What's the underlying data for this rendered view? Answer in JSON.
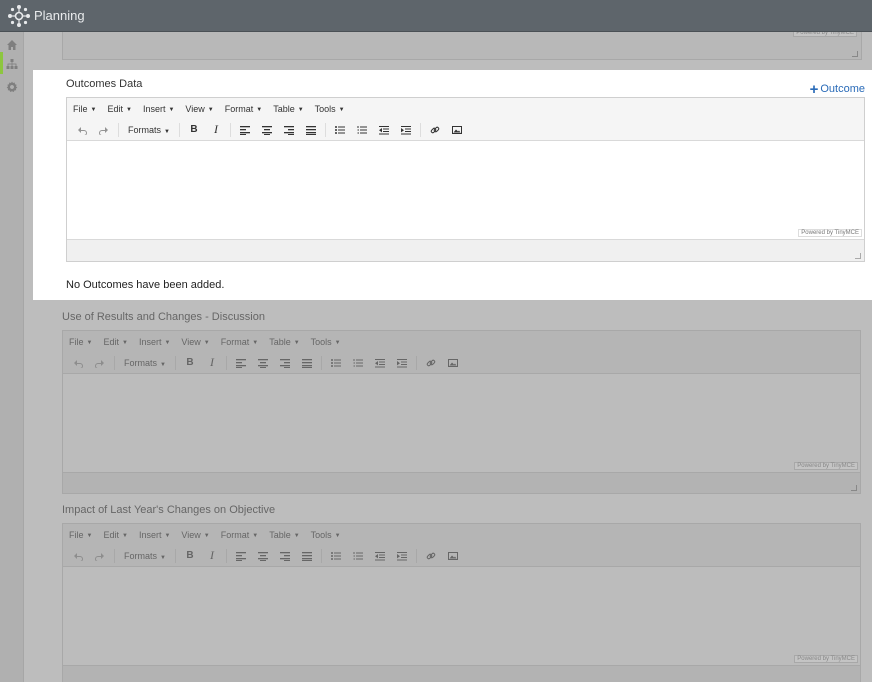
{
  "app": {
    "title": "Planning",
    "brand_icon": "network-hub-icon"
  },
  "sidebar": {
    "items": [
      {
        "icon": "home-icon"
      },
      {
        "icon": "org-chart-icon",
        "active": true
      },
      {
        "icon": "gear-icon"
      }
    ],
    "accent_color": "#8dc63f"
  },
  "editor_menu": [
    "File",
    "Edit",
    "Insert",
    "View",
    "Format",
    "Table",
    "Tools"
  ],
  "editor_toolbar": {
    "formats_label": "Formats"
  },
  "powered_by": "Powered by TinyMCE",
  "sections": {
    "outcomes": {
      "title": "Outcomes Data",
      "add_label": "Outcome",
      "empty_message": "No Outcomes have been added."
    },
    "discussion": {
      "title": "Use of Results and Changes - Discussion"
    },
    "impact": {
      "title": "Impact of Last Year's Changes on Objective"
    }
  },
  "colors": {
    "link": "#2a6bb8",
    "topbar": "#5e656b"
  }
}
